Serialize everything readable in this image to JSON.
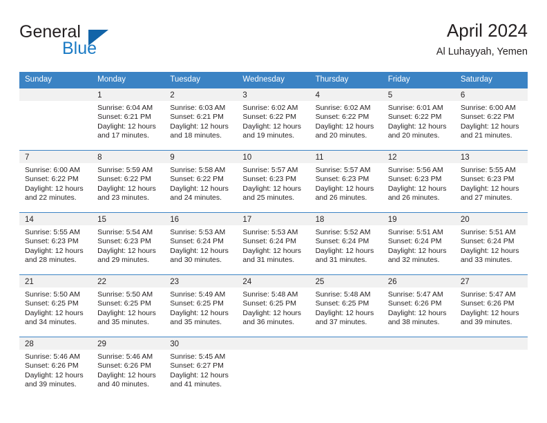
{
  "brand": {
    "name_top": "General",
    "name_bottom": "Blue",
    "accent_color": "#1a7ac4",
    "triangle_color": "#1264a8"
  },
  "header": {
    "title": "April 2024",
    "subtitle": "Al Luhayyah, Yemen"
  },
  "theme": {
    "header_row_bg": "#3b83c4",
    "day_band_bg": "#f1f1f1",
    "text_color": "#231f20"
  },
  "weekday_headers": [
    "Sunday",
    "Monday",
    "Tuesday",
    "Wednesday",
    "Thursday",
    "Friday",
    "Saturday"
  ],
  "labels": {
    "sunrise_prefix": "Sunrise:",
    "sunset_prefix": "Sunset:",
    "daylight_prefix": "Daylight:"
  },
  "weeks": [
    [
      {
        "day": "",
        "sunrise": "",
        "sunset": "",
        "daylight_l1": "",
        "daylight_l2": ""
      },
      {
        "day": "1",
        "sunrise": "Sunrise: 6:04 AM",
        "sunset": "Sunset: 6:21 PM",
        "daylight_l1": "Daylight: 12 hours",
        "daylight_l2": "and 17 minutes."
      },
      {
        "day": "2",
        "sunrise": "Sunrise: 6:03 AM",
        "sunset": "Sunset: 6:21 PM",
        "daylight_l1": "Daylight: 12 hours",
        "daylight_l2": "and 18 minutes."
      },
      {
        "day": "3",
        "sunrise": "Sunrise: 6:02 AM",
        "sunset": "Sunset: 6:22 PM",
        "daylight_l1": "Daylight: 12 hours",
        "daylight_l2": "and 19 minutes."
      },
      {
        "day": "4",
        "sunrise": "Sunrise: 6:02 AM",
        "sunset": "Sunset: 6:22 PM",
        "daylight_l1": "Daylight: 12 hours",
        "daylight_l2": "and 20 minutes."
      },
      {
        "day": "5",
        "sunrise": "Sunrise: 6:01 AM",
        "sunset": "Sunset: 6:22 PM",
        "daylight_l1": "Daylight: 12 hours",
        "daylight_l2": "and 20 minutes."
      },
      {
        "day": "6",
        "sunrise": "Sunrise: 6:00 AM",
        "sunset": "Sunset: 6:22 PM",
        "daylight_l1": "Daylight: 12 hours",
        "daylight_l2": "and 21 minutes."
      }
    ],
    [
      {
        "day": "7",
        "sunrise": "Sunrise: 6:00 AM",
        "sunset": "Sunset: 6:22 PM",
        "daylight_l1": "Daylight: 12 hours",
        "daylight_l2": "and 22 minutes."
      },
      {
        "day": "8",
        "sunrise": "Sunrise: 5:59 AM",
        "sunset": "Sunset: 6:22 PM",
        "daylight_l1": "Daylight: 12 hours",
        "daylight_l2": "and 23 minutes."
      },
      {
        "day": "9",
        "sunrise": "Sunrise: 5:58 AM",
        "sunset": "Sunset: 6:22 PM",
        "daylight_l1": "Daylight: 12 hours",
        "daylight_l2": "and 24 minutes."
      },
      {
        "day": "10",
        "sunrise": "Sunrise: 5:57 AM",
        "sunset": "Sunset: 6:23 PM",
        "daylight_l1": "Daylight: 12 hours",
        "daylight_l2": "and 25 minutes."
      },
      {
        "day": "11",
        "sunrise": "Sunrise: 5:57 AM",
        "sunset": "Sunset: 6:23 PM",
        "daylight_l1": "Daylight: 12 hours",
        "daylight_l2": "and 26 minutes."
      },
      {
        "day": "12",
        "sunrise": "Sunrise: 5:56 AM",
        "sunset": "Sunset: 6:23 PM",
        "daylight_l1": "Daylight: 12 hours",
        "daylight_l2": "and 26 minutes."
      },
      {
        "day": "13",
        "sunrise": "Sunrise: 5:55 AM",
        "sunset": "Sunset: 6:23 PM",
        "daylight_l1": "Daylight: 12 hours",
        "daylight_l2": "and 27 minutes."
      }
    ],
    [
      {
        "day": "14",
        "sunrise": "Sunrise: 5:55 AM",
        "sunset": "Sunset: 6:23 PM",
        "daylight_l1": "Daylight: 12 hours",
        "daylight_l2": "and 28 minutes."
      },
      {
        "day": "15",
        "sunrise": "Sunrise: 5:54 AM",
        "sunset": "Sunset: 6:23 PM",
        "daylight_l1": "Daylight: 12 hours",
        "daylight_l2": "and 29 minutes."
      },
      {
        "day": "16",
        "sunrise": "Sunrise: 5:53 AM",
        "sunset": "Sunset: 6:24 PM",
        "daylight_l1": "Daylight: 12 hours",
        "daylight_l2": "and 30 minutes."
      },
      {
        "day": "17",
        "sunrise": "Sunrise: 5:53 AM",
        "sunset": "Sunset: 6:24 PM",
        "daylight_l1": "Daylight: 12 hours",
        "daylight_l2": "and 31 minutes."
      },
      {
        "day": "18",
        "sunrise": "Sunrise: 5:52 AM",
        "sunset": "Sunset: 6:24 PM",
        "daylight_l1": "Daylight: 12 hours",
        "daylight_l2": "and 31 minutes."
      },
      {
        "day": "19",
        "sunrise": "Sunrise: 5:51 AM",
        "sunset": "Sunset: 6:24 PM",
        "daylight_l1": "Daylight: 12 hours",
        "daylight_l2": "and 32 minutes."
      },
      {
        "day": "20",
        "sunrise": "Sunrise: 5:51 AM",
        "sunset": "Sunset: 6:24 PM",
        "daylight_l1": "Daylight: 12 hours",
        "daylight_l2": "and 33 minutes."
      }
    ],
    [
      {
        "day": "21",
        "sunrise": "Sunrise: 5:50 AM",
        "sunset": "Sunset: 6:25 PM",
        "daylight_l1": "Daylight: 12 hours",
        "daylight_l2": "and 34 minutes."
      },
      {
        "day": "22",
        "sunrise": "Sunrise: 5:50 AM",
        "sunset": "Sunset: 6:25 PM",
        "daylight_l1": "Daylight: 12 hours",
        "daylight_l2": "and 35 minutes."
      },
      {
        "day": "23",
        "sunrise": "Sunrise: 5:49 AM",
        "sunset": "Sunset: 6:25 PM",
        "daylight_l1": "Daylight: 12 hours",
        "daylight_l2": "and 35 minutes."
      },
      {
        "day": "24",
        "sunrise": "Sunrise: 5:48 AM",
        "sunset": "Sunset: 6:25 PM",
        "daylight_l1": "Daylight: 12 hours",
        "daylight_l2": "and 36 minutes."
      },
      {
        "day": "25",
        "sunrise": "Sunrise: 5:48 AM",
        "sunset": "Sunset: 6:25 PM",
        "daylight_l1": "Daylight: 12 hours",
        "daylight_l2": "and 37 minutes."
      },
      {
        "day": "26",
        "sunrise": "Sunrise: 5:47 AM",
        "sunset": "Sunset: 6:26 PM",
        "daylight_l1": "Daylight: 12 hours",
        "daylight_l2": "and 38 minutes."
      },
      {
        "day": "27",
        "sunrise": "Sunrise: 5:47 AM",
        "sunset": "Sunset: 6:26 PM",
        "daylight_l1": "Daylight: 12 hours",
        "daylight_l2": "and 39 minutes."
      }
    ],
    [
      {
        "day": "28",
        "sunrise": "Sunrise: 5:46 AM",
        "sunset": "Sunset: 6:26 PM",
        "daylight_l1": "Daylight: 12 hours",
        "daylight_l2": "and 39 minutes."
      },
      {
        "day": "29",
        "sunrise": "Sunrise: 5:46 AM",
        "sunset": "Sunset: 6:26 PM",
        "daylight_l1": "Daylight: 12 hours",
        "daylight_l2": "and 40 minutes."
      },
      {
        "day": "30",
        "sunrise": "Sunrise: 5:45 AM",
        "sunset": "Sunset: 6:27 PM",
        "daylight_l1": "Daylight: 12 hours",
        "daylight_l2": "and 41 minutes."
      },
      {
        "day": "",
        "sunrise": "",
        "sunset": "",
        "daylight_l1": "",
        "daylight_l2": ""
      },
      {
        "day": "",
        "sunrise": "",
        "sunset": "",
        "daylight_l1": "",
        "daylight_l2": ""
      },
      {
        "day": "",
        "sunrise": "",
        "sunset": "",
        "daylight_l1": "",
        "daylight_l2": ""
      },
      {
        "day": "",
        "sunrise": "",
        "sunset": "",
        "daylight_l1": "",
        "daylight_l2": ""
      }
    ]
  ]
}
